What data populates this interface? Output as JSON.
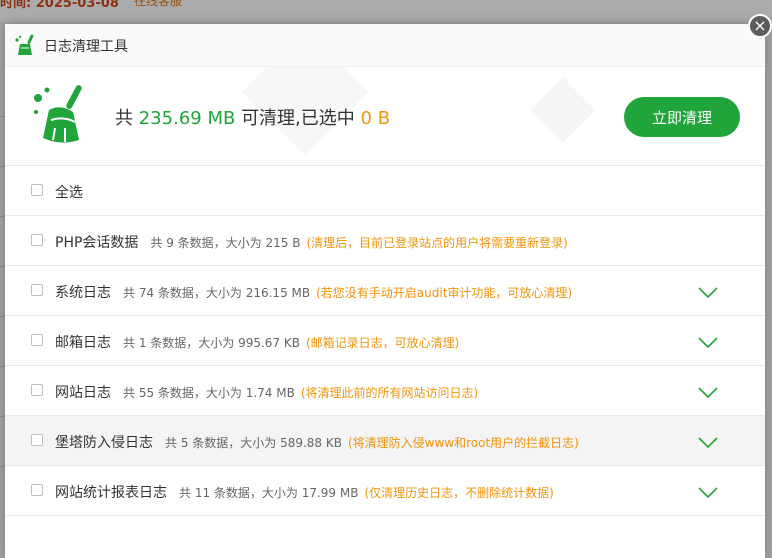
{
  "background": {
    "date_text": "时间: 2025-03-08",
    "service_text": "在线客服"
  },
  "dialog": {
    "title": "日志清理工具",
    "close_symbol": "×"
  },
  "summary": {
    "prefix": "共",
    "total": "235.69 MB",
    "middle": "可清理,已选中",
    "selected": "0 B",
    "clean_button": "立即清理"
  },
  "select_all": "全选",
  "items": [
    {
      "name": "PHP会话数据",
      "info": "共 9 条数据，大小为 215 B",
      "note": "(清理后，目前已登录站点的用户将需要重新登录)",
      "expandable": false
    },
    {
      "name": "系统日志",
      "info": "共 74 条数据，大小为 216.15 MB",
      "note": "(若您没有手动开启audit审计功能，可放心清理)",
      "expandable": true
    },
    {
      "name": "邮箱日志",
      "info": "共 1 条数据，大小为 995.67 KB",
      "note": "(邮箱记录日志，可放心清理)",
      "expandable": true
    },
    {
      "name": "网站日志",
      "info": "共 55 条数据，大小为 1.74 MB",
      "note": "(将清理此前的所有网站访问日志)",
      "expandable": true
    },
    {
      "name": "堡塔防入侵日志",
      "info": "共 5 条数据，大小为 589.88 KB",
      "note": "(将清理防入侵www和root用户的拦截日志)",
      "expandable": true
    },
    {
      "name": "网站统计报表日志",
      "info": "共 11 条数据，大小为 17.99 MB",
      "note": "(仅清理历史日志，不删除统计数据)",
      "expandable": true
    }
  ],
  "colors": {
    "accent": "#20a53a",
    "highlight": "#f0940a"
  }
}
